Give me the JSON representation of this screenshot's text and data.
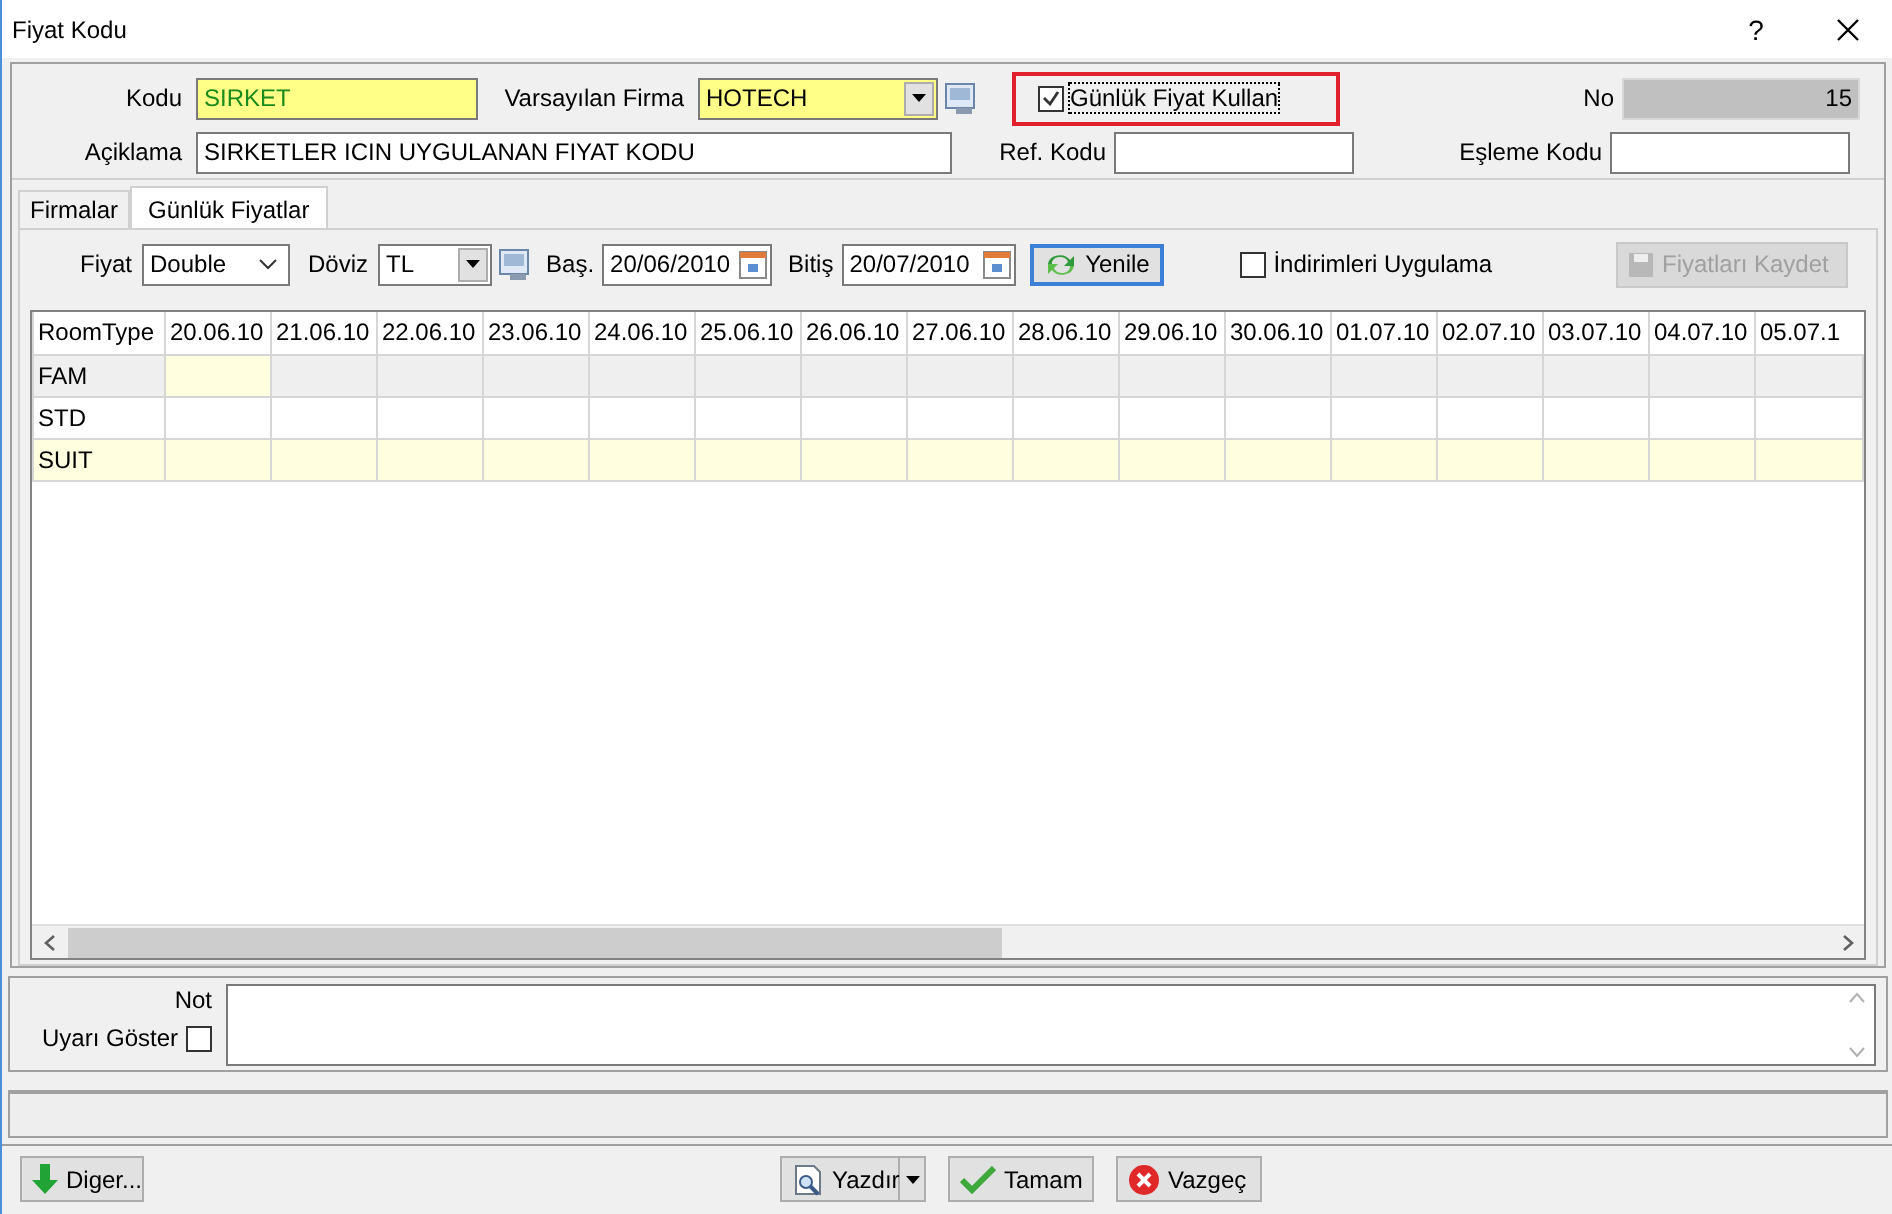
{
  "window": {
    "title": "Fiyat Kodu",
    "help": "?"
  },
  "header": {
    "kodu": {
      "label": "Kodu",
      "value": "SIRKET"
    },
    "varsayilan_firma": {
      "label": "Varsayılan Firma",
      "value": "HOTECH"
    },
    "gunluk_fiyat": {
      "label": "Günlük Fiyat Kullan",
      "checked": true,
      "highlighted": true
    },
    "no": {
      "label": "No",
      "value": "15"
    },
    "aciklama": {
      "label": "Açiklama",
      "value": "SIRKETLER ICIN UYGULANAN FIYAT KODU"
    },
    "ref_kodu": {
      "label": "Ref. Kodu"
    },
    "esleme_kodu": {
      "label": "Eşleme Kodu"
    }
  },
  "tabs": [
    {
      "label": "Firmalar",
      "selected": false
    },
    {
      "label": "Günlük Fiyatlar",
      "selected": true
    }
  ],
  "toolbar": {
    "fiyat": {
      "label": "Fiyat",
      "value": "Double"
    },
    "doviz": {
      "label": "Döviz",
      "value": "TL"
    },
    "bas": {
      "label": "Baş.",
      "value": "20/06/2010"
    },
    "bitis": {
      "label": "Bitiş",
      "value": "20/07/2010"
    },
    "yenile": "Yenile",
    "indirim": {
      "label": "İndirimleri Uygulama",
      "checked": false
    },
    "kaydet": {
      "label": "Fiyatları Kaydet",
      "disabled": true
    }
  },
  "table": {
    "columns": [
      "RoomType",
      "20.06.10",
      "21.06.10",
      "22.06.10",
      "23.06.10",
      "24.06.10",
      "25.06.10",
      "26.06.10",
      "27.06.10",
      "28.06.10",
      "29.06.10",
      "30.06.10",
      "01.07.10",
      "02.07.10",
      "03.07.10",
      "04.07.10",
      "05.07.1"
    ],
    "rows": [
      {
        "name": "FAM",
        "focused": true,
        "selected": false
      },
      {
        "name": "STD",
        "focused": false,
        "selected": false
      },
      {
        "name": "SUIT",
        "focused": false,
        "selected": true
      }
    ]
  },
  "notes": {
    "label": "Not",
    "uyari": {
      "label": "Uyarı Göster",
      "checked": false
    }
  },
  "footer": {
    "diger": "Diger...",
    "yazdir": "Yazdır",
    "tamam": "Tamam",
    "vazgec": "Vazgeç"
  }
}
